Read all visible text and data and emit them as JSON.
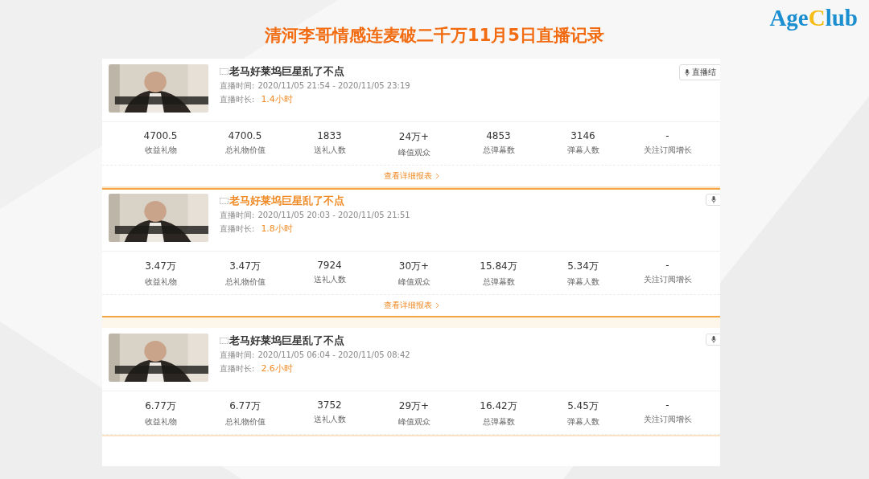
{
  "slide_title": "清河李哥情感连麦破二千万11月5日直播记录",
  "logo": {
    "parts": [
      {
        "text": "Age",
        "color": "#1b8fd0"
      },
      {
        "text": "C",
        "color": "#f6bd16"
      },
      {
        "text": "lub",
        "color": "#1b8fd0"
      }
    ]
  },
  "records": [
    {
      "selected": false,
      "title": "老马好莱坞巨星乱了不点",
      "time_label": "直播时间:",
      "time": "2020/11/05 21:54 - 2020/11/05 23:19",
      "duration_label": "直播时长:",
      "duration": "1.4小时",
      "status_button": "直播结",
      "report_link": "查看详细报表",
      "stats": [
        {
          "value": "4700.5",
          "label": "收益礼物"
        },
        {
          "value": "4700.5",
          "label": "总礼物价值"
        },
        {
          "value": "1833",
          "label": "送礼人数"
        },
        {
          "value": "24万+",
          "label": "峰值观众"
        },
        {
          "value": "4853",
          "label": "总弹幕数"
        },
        {
          "value": "3146",
          "label": "弹幕人数"
        },
        {
          "value": "-",
          "label": "关注订阅增长"
        }
      ]
    },
    {
      "selected": true,
      "title": "老马好莱坞巨星乱了不点",
      "time_label": "直播时间:",
      "time": "2020/11/05 20:03 - 2020/11/05 21:51",
      "duration_label": "直播时长:",
      "duration": "1.8小时",
      "report_link": "查看详细报表",
      "stats": [
        {
          "value": "3.47万",
          "label": "收益礼物"
        },
        {
          "value": "3.47万",
          "label": "总礼物价值"
        },
        {
          "value": "7924",
          "label": "送礼人数"
        },
        {
          "value": "30万+",
          "label": "峰值观众"
        },
        {
          "value": "15.84万",
          "label": "总弹幕数"
        },
        {
          "value": "5.34万",
          "label": "弹幕人数"
        },
        {
          "value": "-",
          "label": "关注订阅增长"
        }
      ]
    },
    {
      "selected": false,
      "title": "老马好莱坞巨星乱了不点",
      "time_label": "直播时间:",
      "time": "2020/11/05 06:04 - 2020/11/05 08:42",
      "duration_label": "直播时长:",
      "duration": "2.6小时",
      "stats": [
        {
          "value": "6.77万",
          "label": "收益礼物"
        },
        {
          "value": "6.77万",
          "label": "总礼物价值"
        },
        {
          "value": "3752",
          "label": "送礼人数"
        },
        {
          "value": "29万+",
          "label": "峰值观众"
        },
        {
          "value": "16.42万",
          "label": "总弹幕数"
        },
        {
          "value": "5.45万",
          "label": "弹幕人数"
        },
        {
          "value": "-",
          "label": "关注订阅增长"
        }
      ]
    }
  ]
}
